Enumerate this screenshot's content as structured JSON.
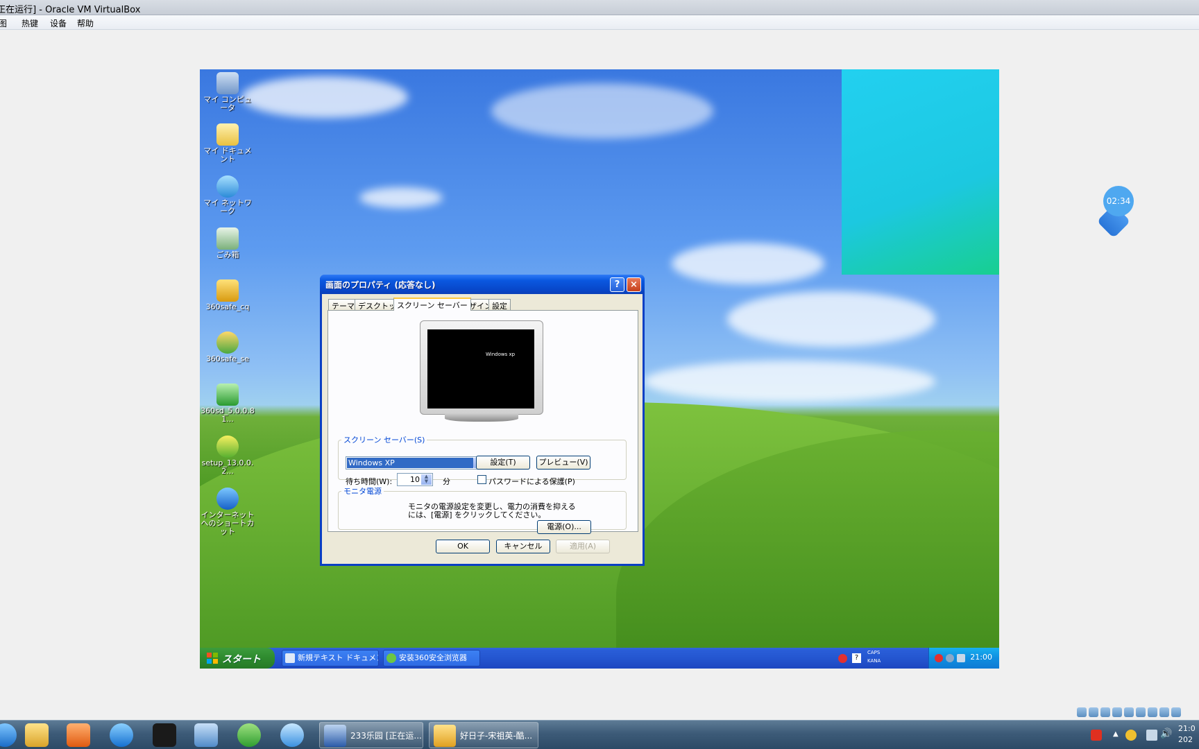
{
  "host": {
    "window_title": "[正在运行] - Oracle VM VirtualBox",
    "menu": [
      "视图",
      "热键",
      "设备",
      "帮助"
    ]
  },
  "guest": {
    "desktop_icons": [
      {
        "label": "マイ コンピュータ",
        "icon": "my-computer-icon"
      },
      {
        "label": "マイ ドキュメント",
        "icon": "my-documents-icon"
      },
      {
        "label": "マイ ネットワーク",
        "icon": "my-network-icon"
      },
      {
        "label": "ごみ箱",
        "icon": "recycle-bin-icon"
      },
      {
        "label": "360safe_cq",
        "icon": "360safe-cq-icon"
      },
      {
        "label": "360safe_se",
        "icon": "360safe-se-icon"
      },
      {
        "label": "360sd_5.0.0.81...",
        "icon": "360sd-icon"
      },
      {
        "label": "setup_13.0.0.2...",
        "icon": "setup-icon"
      },
      {
        "label": "インターネット へのショートカット",
        "icon": "internet-shortcut-icon"
      }
    ],
    "dialog": {
      "title": "画面のプロパティ (応答なし)",
      "help": "?",
      "close": "×",
      "tabs": [
        "テーマ",
        "デスクトップ",
        "スクリーン セーバー",
        "デザイン",
        "設定"
      ],
      "active_tab": "スクリーン セーバー",
      "preview_logo": "Windows xp",
      "screensaver_group": "スクリーン セーバー(S)",
      "screensaver_value": "Windows XP",
      "settings_button": "設定(T)",
      "preview_button": "プレビュー(V)",
      "wait_label": "待ち時間(W):",
      "wait_value": "10",
      "wait_unit": "分",
      "password_label": "パスワードによる保護(P)",
      "monitor_group": "モニタ電源",
      "monitor_text_1": "モニタの電源設定を変更し、電力の消費を抑える",
      "monitor_text_2": "には、[電源] をクリックしてください。",
      "power_button": "電源(O)...",
      "ok_button": "OK",
      "cancel_button": "キャンセル",
      "apply_button": "適用(A)"
    },
    "taskbar": {
      "start_label": "スタート",
      "tasks": [
        "新規テキスト ドキュメン...",
        "安装360安全浏览器"
      ],
      "tray_caps": "CAPS",
      "tray_kana": "KANA",
      "clock": "21:00"
    }
  },
  "widget": {
    "timer": "02:34"
  },
  "host_taskbar": {
    "tasks": [
      "233乐园 [正在运...",
      "好日子-宋祖英-酷..."
    ],
    "clock": "21:0",
    "date": "202"
  }
}
